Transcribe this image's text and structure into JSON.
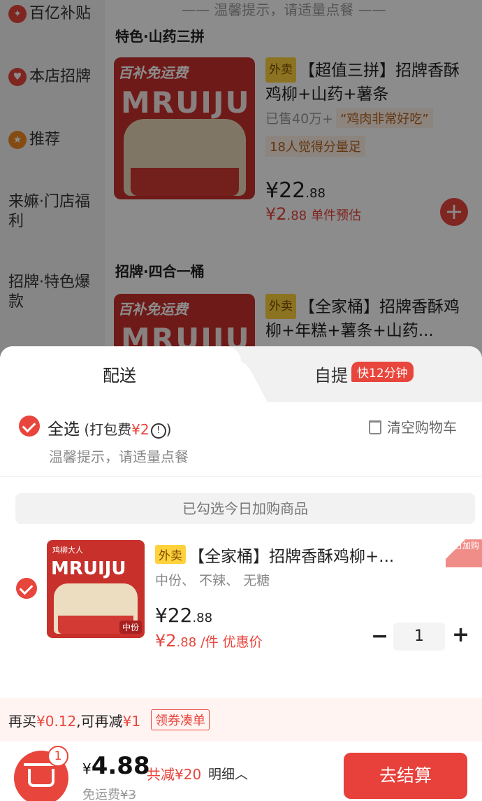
{
  "sidebar": {
    "items": [
      {
        "label": "百亿补贴",
        "icon": "fire-icon"
      },
      {
        "label": "本店招牌",
        "icon": "thumb-up-icon"
      },
      {
        "label": "推荐",
        "icon": "badge-icon"
      },
      {
        "label": "来嫲·门店福利"
      },
      {
        "label": "招牌·特色爆款"
      }
    ]
  },
  "menu": {
    "top_tip": "—— 温馨提示，请适量点餐 ——",
    "sections": [
      {
        "title": "特色·山药三拼",
        "product": {
          "image_banner": "百补免运费",
          "image_brand": "MRUIJU",
          "tag": "外卖",
          "name": "【超值三拼】招牌香酥鸡柳+山药+薯条",
          "sold": "已售40万+",
          "quote": "“鸡肉非常好吃”",
          "feeling": "18人觉得分量足",
          "price_int": "¥22",
          "price_dec": ".88",
          "disc_int": "¥2",
          "disc_dec": ".88",
          "disc_note": "单件预估",
          "add_symbol": "+"
        }
      },
      {
        "title": "招牌·四合一桶",
        "product": {
          "image_banner": "百补免运费",
          "image_brand": "MRUIJU",
          "tag": "外卖",
          "name": "【全家桶】招牌香酥鸡柳+年糕+薯条+山药..."
        }
      }
    ]
  },
  "cart": {
    "tabs": [
      {
        "label": "配送",
        "active": true
      },
      {
        "label": "自提",
        "active": false,
        "badge": "快12分钟"
      }
    ],
    "select_all": {
      "label": "全选",
      "fee_prefix": " (打包费",
      "fee_value": "¥2",
      "fee_suffix": ")",
      "info_symbol": "!"
    },
    "clear_label": "清空购物车",
    "hint": "温馨提示，请适量点餐",
    "checked_banner": "已勾选今日加购商品",
    "item": {
      "image_logo": "鸡柳大人",
      "image_brand": "MRUIJU",
      "image_size": "中份",
      "tag": "外卖",
      "title": "【全家桶】招牌香酥鸡柳+...",
      "corner": "今日加购",
      "specs": "中份、 不辣、 无糖",
      "price_int": "¥22",
      "price_dec": ".88",
      "disc_int": "¥2",
      "disc_dec": ".88",
      "disc_unit": " /件 ",
      "disc_label": "优惠价",
      "quantity": "1",
      "minus": "−",
      "plus": "+"
    },
    "promo": {
      "prefix": "再买",
      "amount": "¥0.12",
      "middle": ",可再减",
      "reduce": "¥1",
      "coupon_label": "领券凑单"
    },
    "footer": {
      "cart_count": "1",
      "total_yen": "¥",
      "total_value": "4.88",
      "saved": "共减¥20",
      "detail": "明细︿",
      "free_ship_label": "免运费",
      "free_ship_orig": "¥3",
      "checkout_label": "去结算"
    }
  },
  "colors": {
    "accent": "#e8453c",
    "tag_yellow": "#ffd23c",
    "promo_bg": "#fff4f2"
  }
}
